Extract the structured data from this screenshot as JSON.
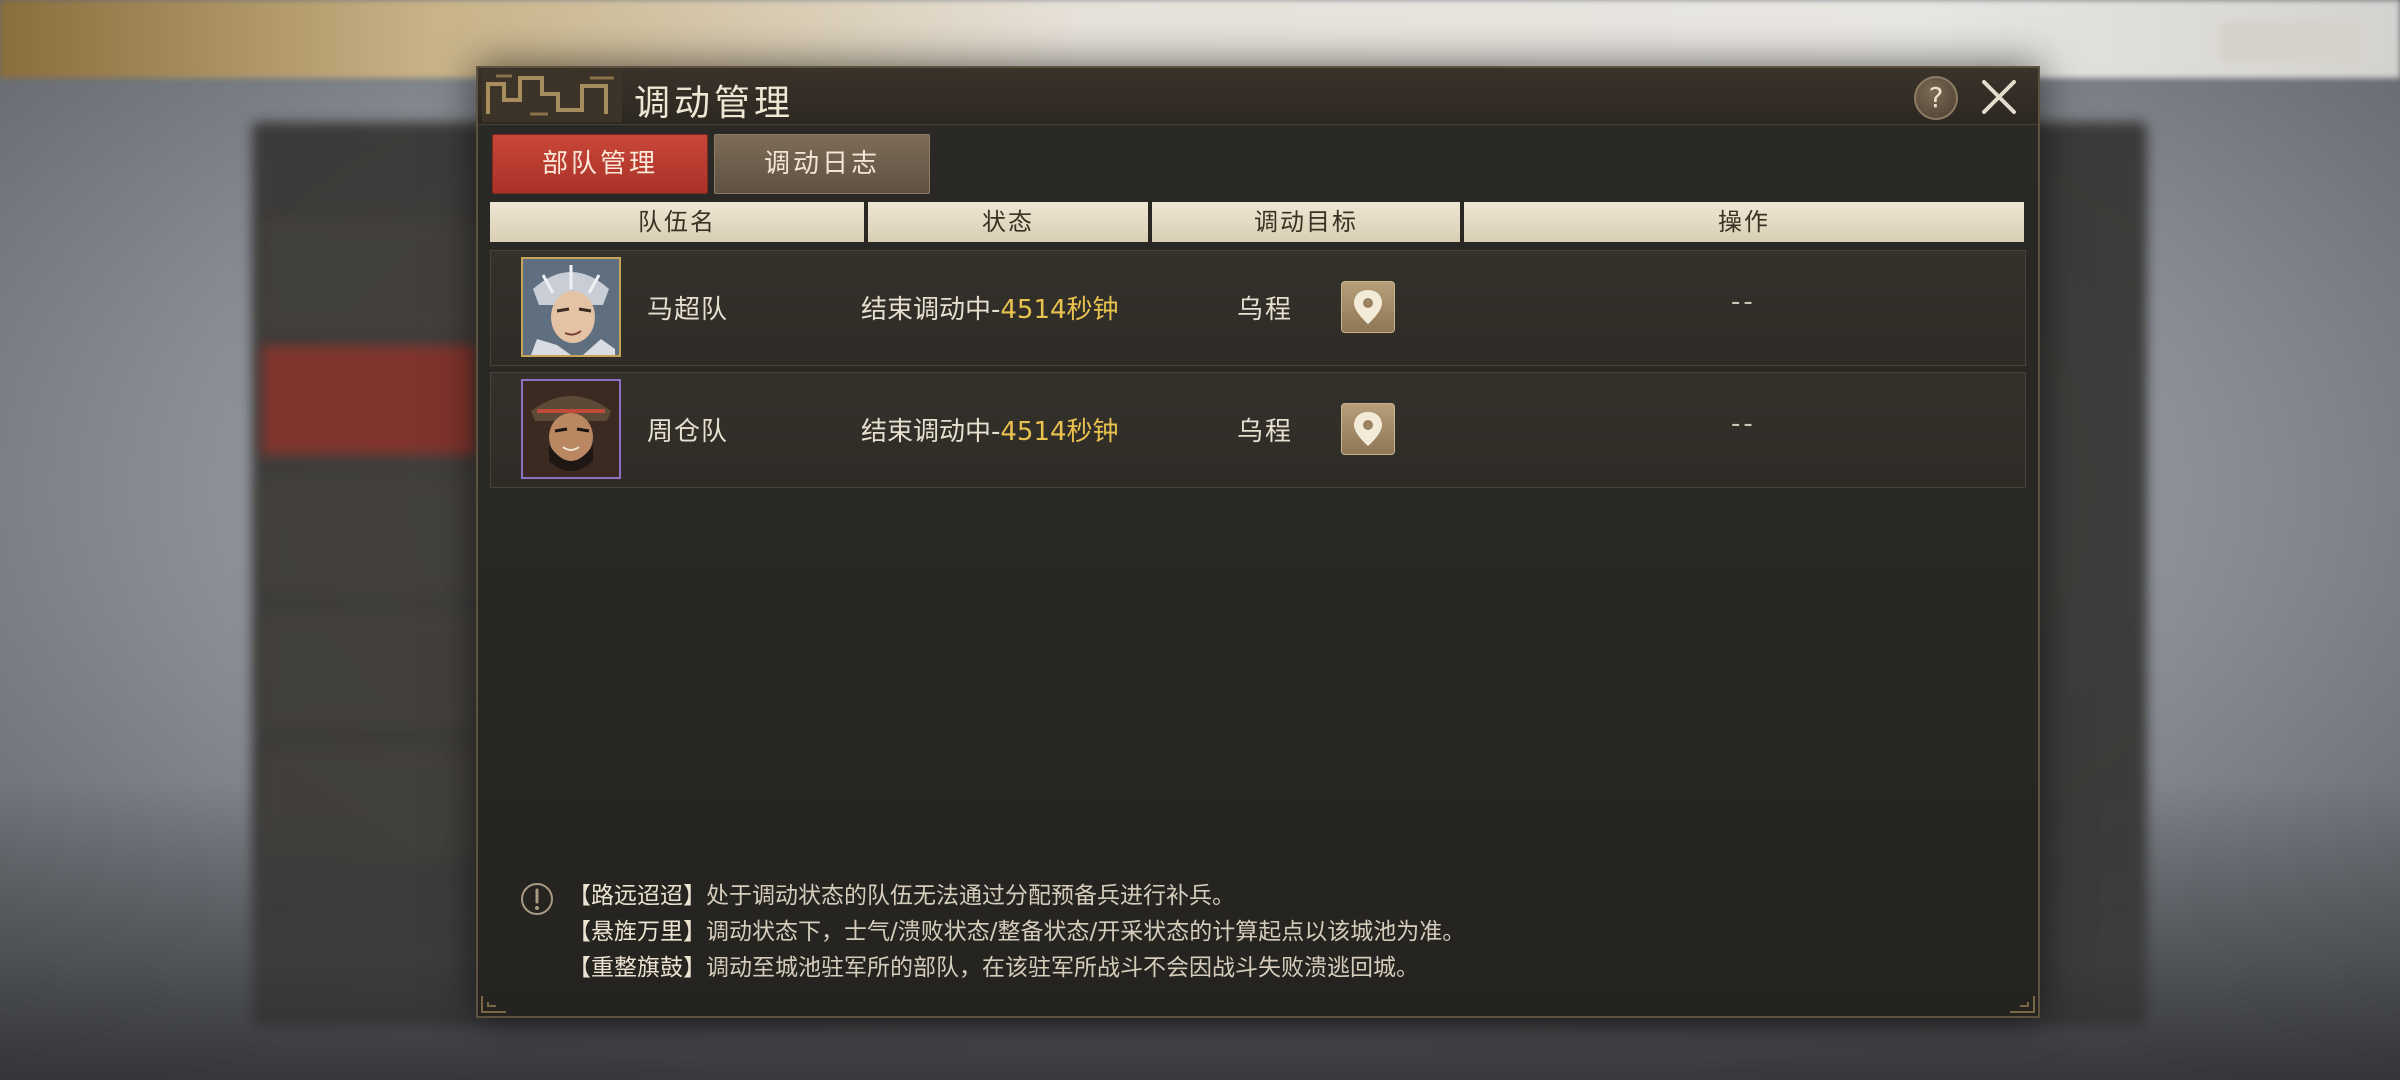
{
  "dialog": {
    "title": "调动管理",
    "help_label": "?"
  },
  "tabs": [
    {
      "label": "部队管理",
      "active": true
    },
    {
      "label": "调动日志",
      "active": false
    }
  ],
  "table": {
    "headers": [
      "队伍名",
      "状态",
      "调动目标",
      "操作"
    ],
    "rows": [
      {
        "name": "马超队",
        "status_prefix": "结束调动中-",
        "status_countdown": "4514秒钟",
        "target": "乌程",
        "action": "--",
        "portrait": "hero-portrait-machao"
      },
      {
        "name": "周仓队",
        "status_prefix": "结束调动中-",
        "status_countdown": "4514秒钟",
        "target": "乌程",
        "action": "--",
        "portrait": "hero-portrait-zhoucang"
      }
    ]
  },
  "notes": [
    {
      "head": "【路远迢迢】",
      "text": "处于调动状态的队伍无法通过分配预备兵进行补兵。"
    },
    {
      "head": "【悬旌万里】",
      "text": "调动状态下，士气/溃败状态/整备状态/开采状态的计算起点以该城池为准。"
    },
    {
      "head": "【重整旗鼓】",
      "text": "调动至城池驻军所的部队，在该驻军所战斗不会因战斗失败溃逃回城。"
    }
  ],
  "colors": {
    "accent_red": "#c9473a",
    "countdown_yellow": "#e9c14e",
    "header_bg": "#efe7d4"
  },
  "icons": [
    "help-icon",
    "close-icon",
    "location-pin-icon",
    "info-icon"
  ]
}
